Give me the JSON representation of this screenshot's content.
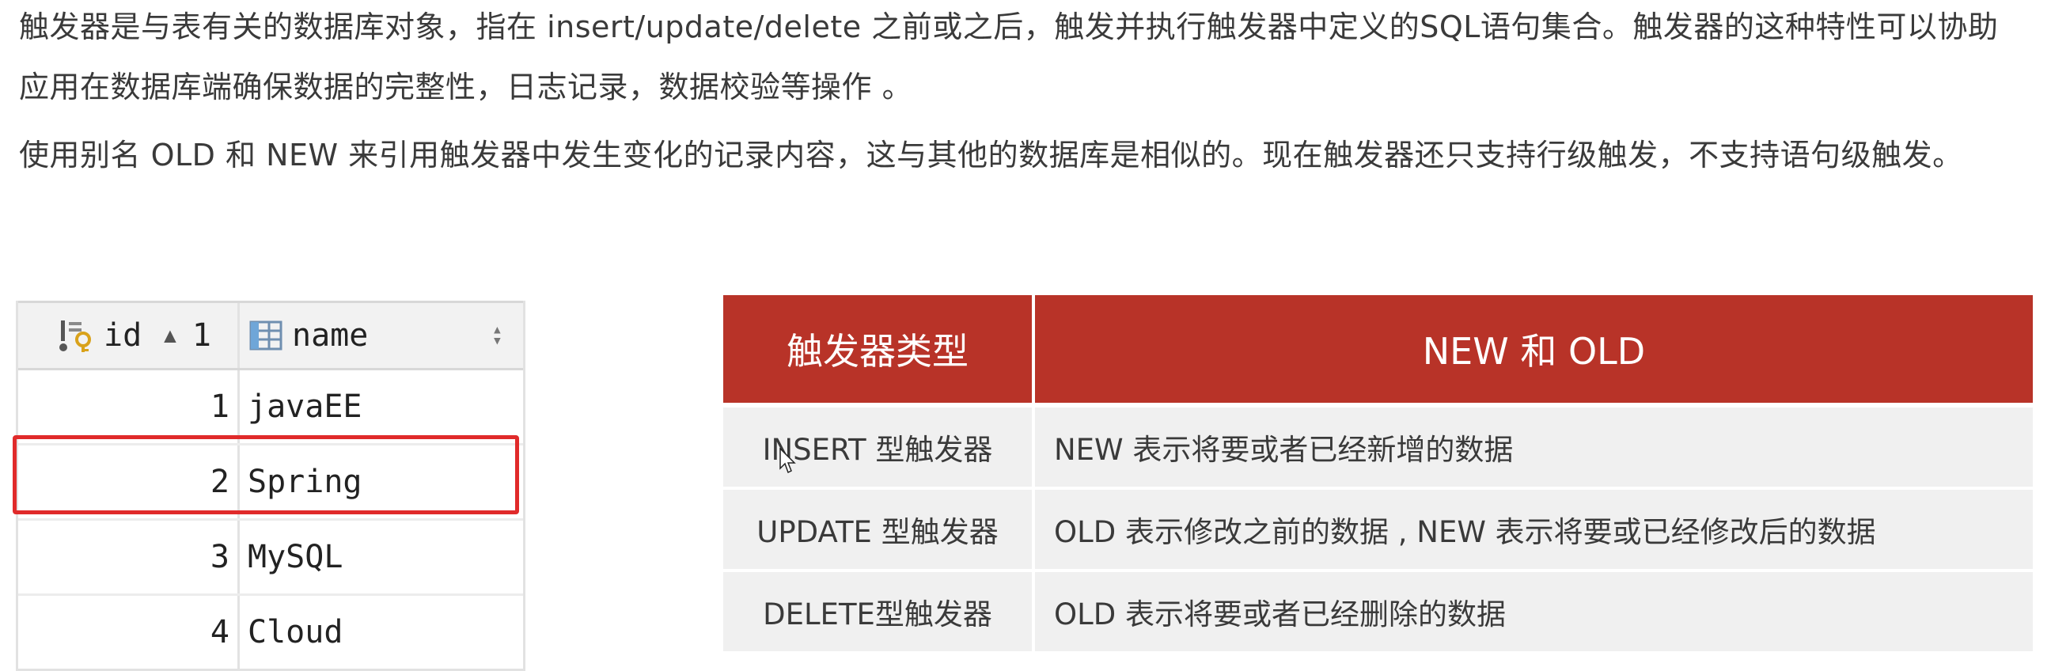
{
  "intro": {
    "paragraph1": "触发器是与表有关的数据库对象，指在 insert/update/delete 之前或之后，触发并执行触发器中定义的SQL语句集合。触发器的这种特性可以协助应用在数据库端确保数据的完整性，日志记录，数据校验等操作 。",
    "paragraph2": "使用别名 OLD 和 NEW 来引用触发器中发生变化的记录内容，这与其他的数据库是相似的。现在触发器还只支持行级触发，不支持语句级触发。"
  },
  "result_grid": {
    "columns": [
      {
        "label": "id",
        "icon": "primary-key-column-icon",
        "sort": "ascending",
        "sort_order": "1"
      },
      {
        "label": "name",
        "icon": "table-column-icon",
        "sort": "none"
      }
    ],
    "rows": [
      {
        "id": "1",
        "name": "javaEE"
      },
      {
        "id": "2",
        "name": "Spring",
        "highlighted": true
      },
      {
        "id": "3",
        "name": "MySQL"
      },
      {
        "id": "4",
        "name": "Cloud"
      }
    ],
    "highlight_color": "#e02a2a"
  },
  "trigger_table": {
    "header": [
      "触发器类型",
      "NEW 和 OLD"
    ],
    "rows": [
      [
        "INSERT 型触发器",
        "NEW 表示将要或者已经新增的数据"
      ],
      [
        "UPDATE 型触发器",
        "OLD 表示修改之前的数据 , NEW 表示将要或已经修改后的数据"
      ],
      [
        "DELETE型触发器",
        "OLD 表示将要或者已经删除的数据"
      ]
    ],
    "header_color": "#b83328",
    "row_color": "#f0f0f0"
  },
  "colors": {
    "text": "#3a3a3a"
  }
}
